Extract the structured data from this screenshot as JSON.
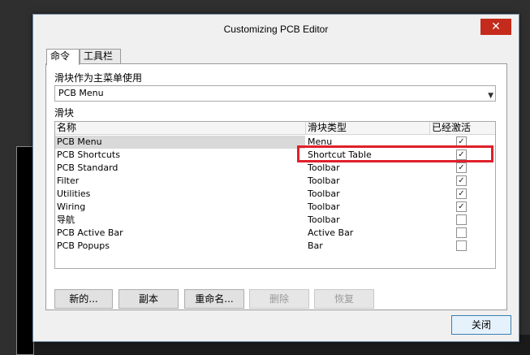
{
  "window": {
    "title": "Customizing PCB Editor",
    "close_glyph": "✕"
  },
  "tabs": [
    {
      "label": "命令"
    },
    {
      "label": "工具栏"
    }
  ],
  "menu_section": {
    "label": "滑块作为主菜单使用",
    "selected": "PCB Menu"
  },
  "sliders_section": {
    "label": "滑块",
    "columns": {
      "name": "名称",
      "type": "滑块类型",
      "active": "已经激活"
    },
    "rows": [
      {
        "name": "PCB Menu",
        "type": "Menu",
        "active": true
      },
      {
        "name": "PCB Shortcuts",
        "type": "Shortcut Table",
        "active": true
      },
      {
        "name": "PCB Standard",
        "type": "Toolbar",
        "active": true
      },
      {
        "name": "Filter",
        "type": "Toolbar",
        "active": true
      },
      {
        "name": "Utilities",
        "type": "Toolbar",
        "active": true
      },
      {
        "name": "Wiring",
        "type": "Toolbar",
        "active": true
      },
      {
        "name": "导航",
        "type": "Toolbar",
        "active": false
      },
      {
        "name": "PCB Active Bar",
        "type": "Active Bar",
        "active": false
      },
      {
        "name": "PCB Popups",
        "type": "Bar",
        "active": false
      }
    ]
  },
  "buttons": {
    "new": "新的...",
    "copy": "副本",
    "rename": "重命名...",
    "delete": "删除",
    "restore": "恢复",
    "close": "关闭"
  },
  "check_glyph": "✓",
  "colors": {
    "highlight": "#e0202a",
    "close_red": "#c42b1c"
  }
}
